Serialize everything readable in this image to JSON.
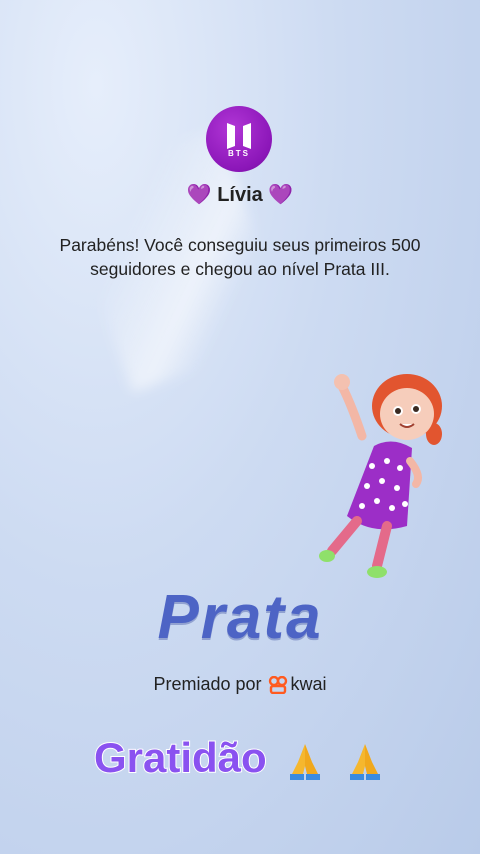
{
  "profile": {
    "avatar_text": "BTS",
    "heart_left": "💜",
    "name": "Lívia",
    "heart_right": "💜"
  },
  "achievement": {
    "message": "Parabéns! Você conseguiu seus primeiros 500 seguidores e chegou ao nível Prata III.",
    "level": "Prata",
    "awarded_by_label": "Premiado por",
    "brand": "kwai"
  },
  "caption": {
    "text": "Gratidão"
  },
  "icons": {
    "avatar": "bts-logo-icon",
    "hearts": "purple-heart-icon",
    "brand": "kwai-logo-icon",
    "pray": "folded-hands-icon",
    "character": "dancing-girl-illustration"
  },
  "colors": {
    "avatar_purple": "#8b16b8",
    "level_blue": "#4d64c5",
    "caption_purple": "#8a52f0",
    "kwai_orange": "#ff5a1f"
  }
}
